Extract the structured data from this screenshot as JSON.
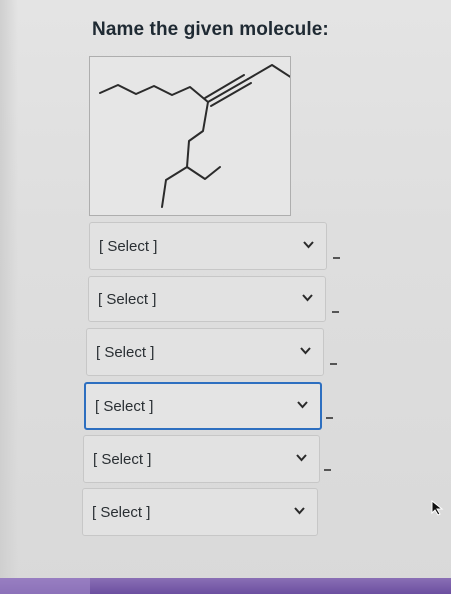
{
  "question": {
    "title": "Name the given molecule:"
  },
  "selects": [
    {
      "value": "[ Select ]",
      "chevron_icon": "chevron-down-icon"
    },
    {
      "value": "[ Select ]",
      "chevron_icon": "chevron-down-icon"
    },
    {
      "value": "[ Select ]",
      "chevron_icon": "chevron-down-icon"
    },
    {
      "value": "[ Select ]",
      "chevron_icon": "chevron-down-icon",
      "focused": true
    },
    {
      "value": "[ Select ]",
      "chevron_icon": "chevron-down-icon"
    },
    {
      "value": "[ Select ]",
      "chevron_icon": "chevron-down-icon"
    }
  ],
  "colors": {
    "focus_border": "#2d6fc0",
    "title_text": "#1f2a33",
    "bottom_bar": "#6b4fa0"
  }
}
